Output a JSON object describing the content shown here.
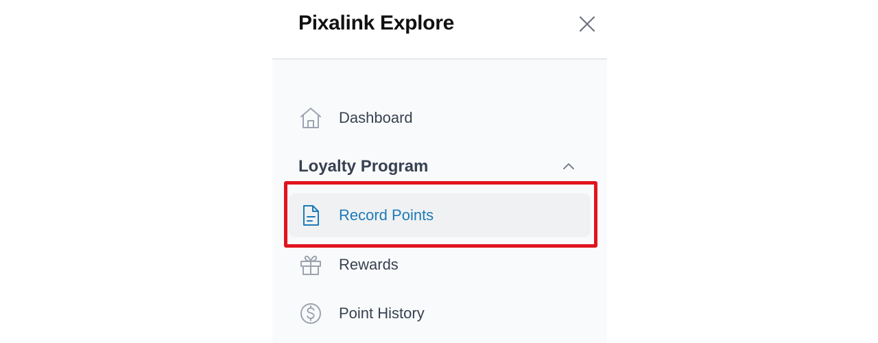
{
  "app": {
    "title": "Pixalink Explore"
  },
  "header": {
    "close_icon": "close-icon"
  },
  "nav": {
    "dashboard": {
      "label": "Dashboard",
      "icon": "home-icon"
    },
    "loyalty_section": {
      "label": "Loyalty Program",
      "icon": "chevron-up-icon",
      "expanded": true
    },
    "items": [
      {
        "label": "Record Points",
        "icon": "document-icon",
        "active": true
      },
      {
        "label": "Rewards",
        "icon": "gift-icon",
        "active": false
      },
      {
        "label": "Point History",
        "icon": "dollar-circle-icon",
        "active": false
      }
    ]
  },
  "colors": {
    "active_text": "#1a7ab8",
    "active_bg": "#f0f1f3",
    "panel_bg": "#f9fafb",
    "highlight": "#e0141e",
    "icon_gray": "#9ca3af"
  }
}
